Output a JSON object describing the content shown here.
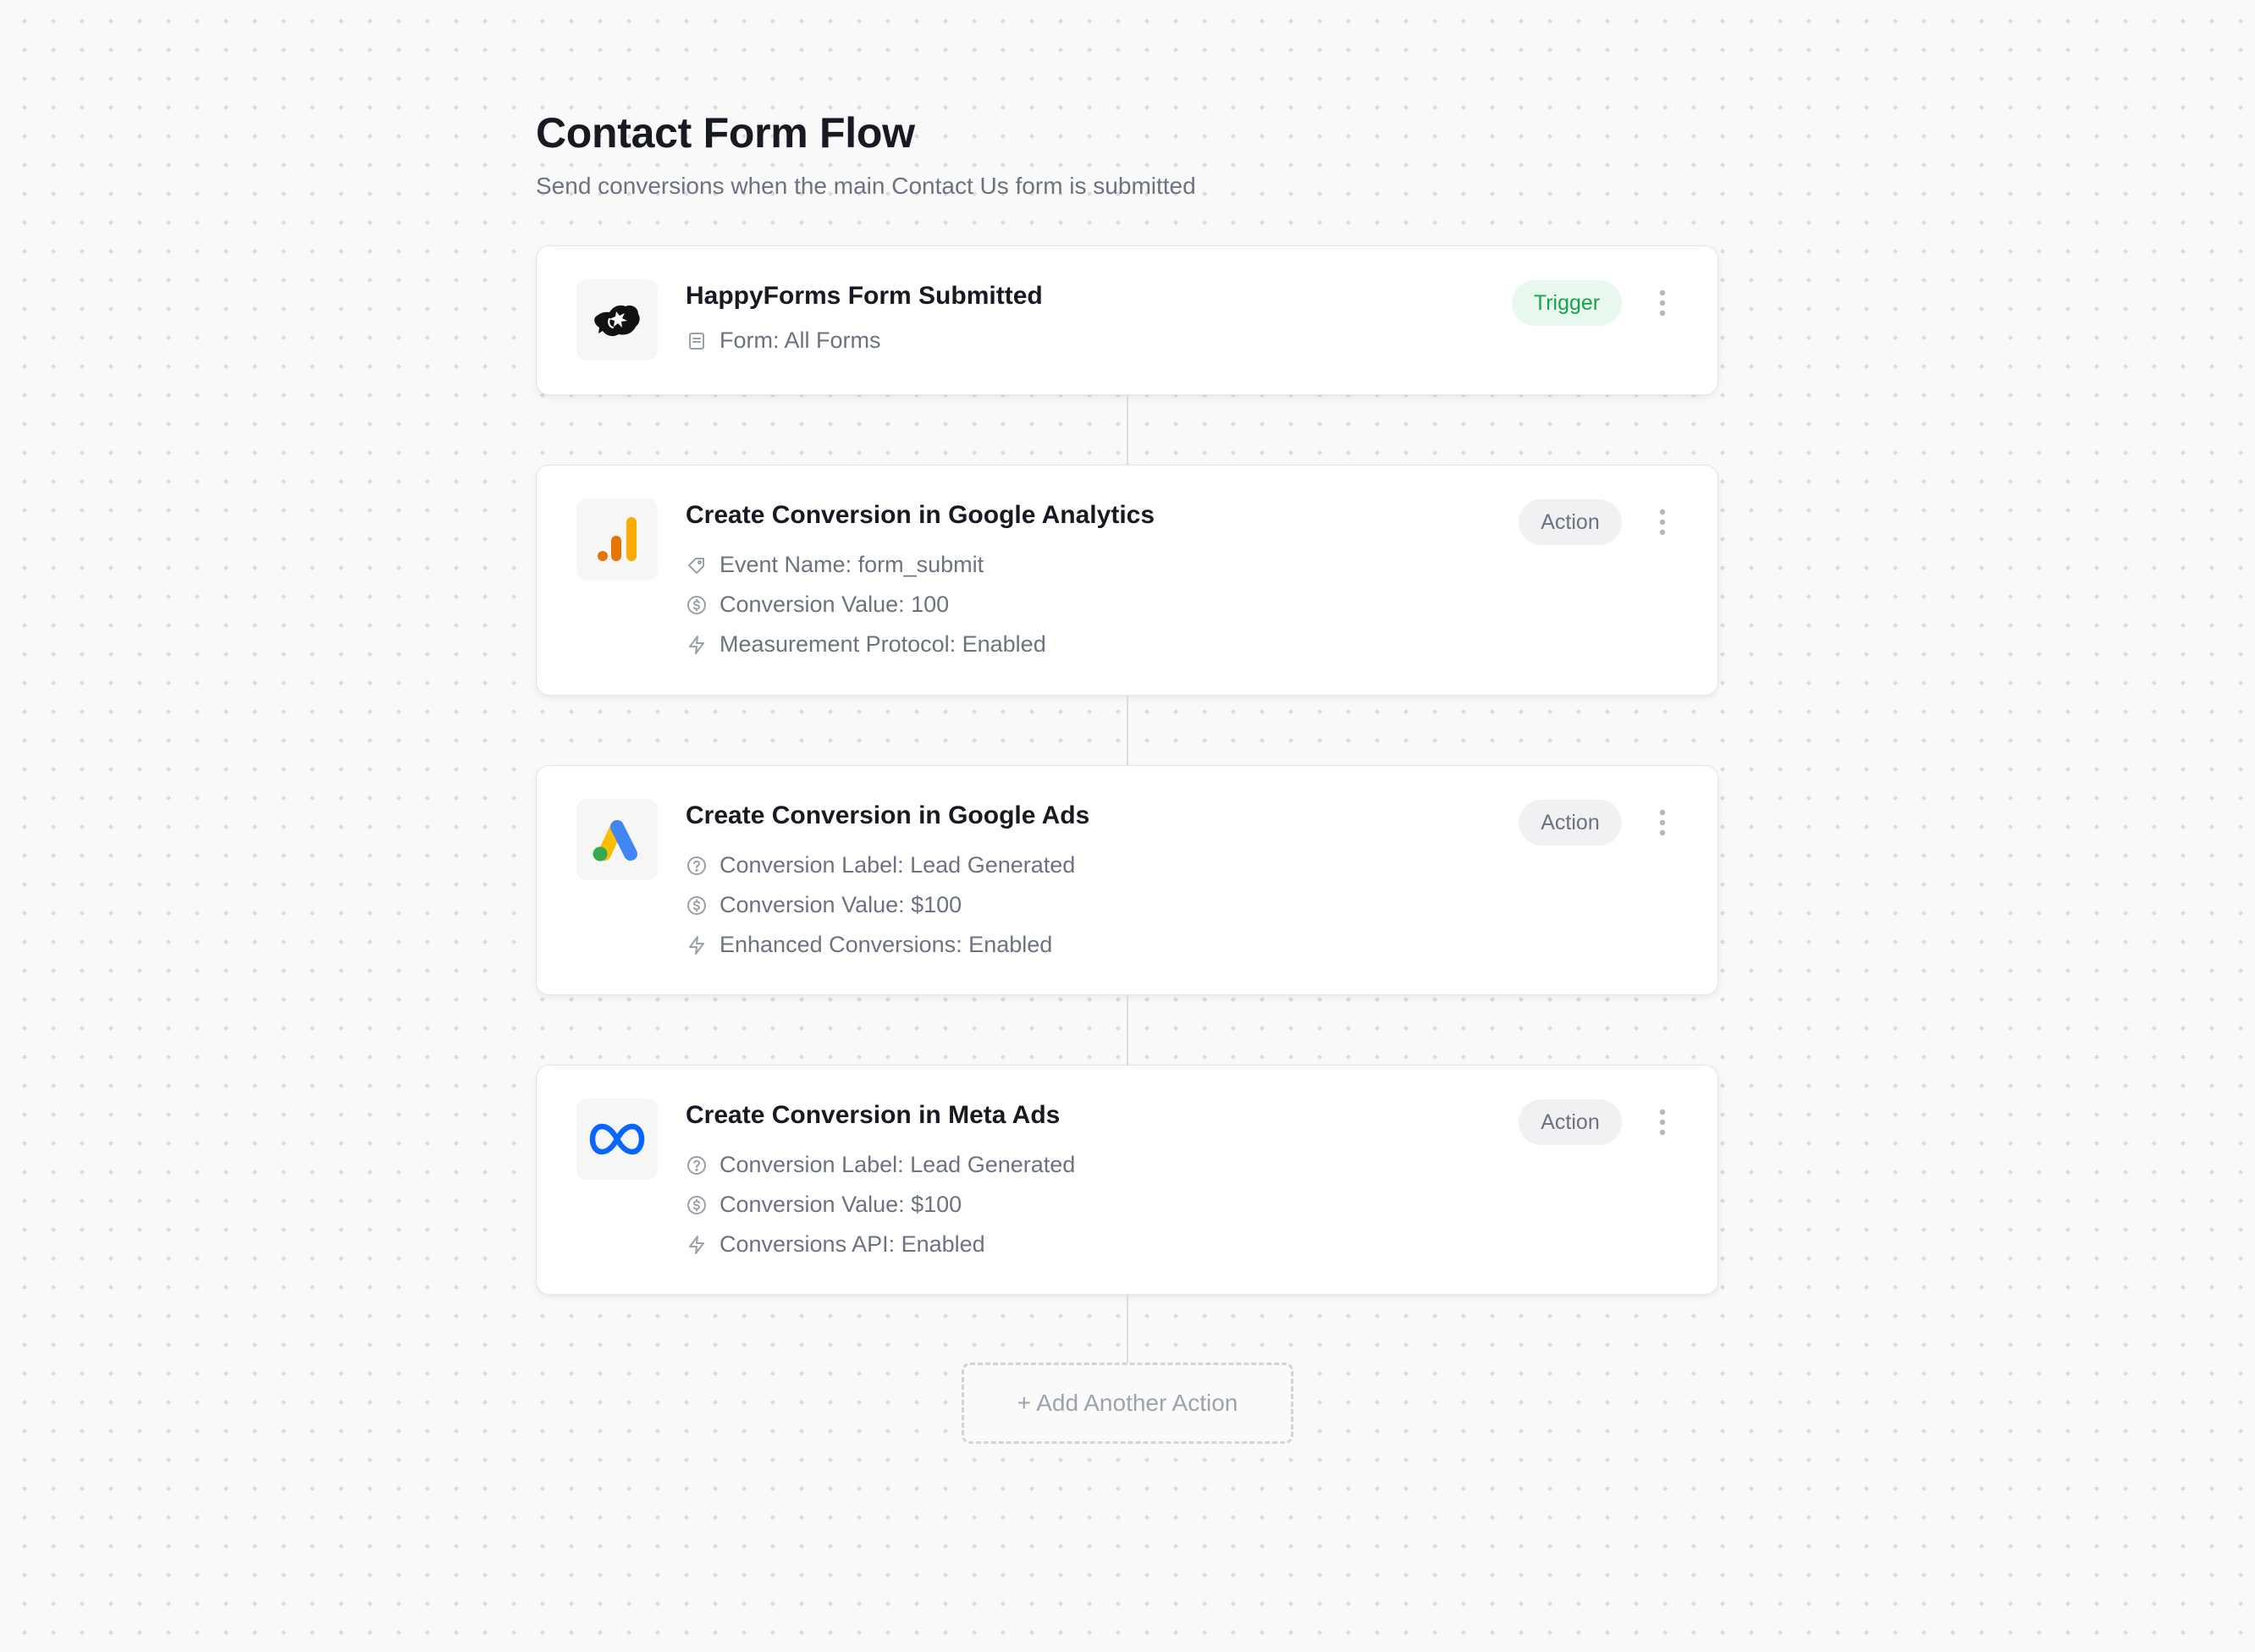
{
  "header": {
    "title": "Contact Form Flow",
    "subtitle": "Send conversions when the main Contact Us form is submitted"
  },
  "steps": [
    {
      "title": "HappyForms Form Submitted",
      "badge": "Trigger",
      "icon": "happyforms-logo",
      "details": [
        {
          "icon": "document-icon",
          "text": "Form: All Forms"
        }
      ]
    },
    {
      "title": "Create Conversion in Google Analytics",
      "badge": "Action",
      "icon": "google-analytics-logo",
      "details": [
        {
          "icon": "tag-icon",
          "text": "Event Name: form_submit"
        },
        {
          "icon": "dollar-circle-icon",
          "text": "Conversion Value: 100"
        },
        {
          "icon": "lightning-icon",
          "text": "Measurement Protocol: Enabled"
        }
      ]
    },
    {
      "title": "Create Conversion in Google Ads",
      "badge": "Action",
      "icon": "google-ads-logo",
      "details": [
        {
          "icon": "help-circle-icon",
          "text": "Conversion Label: Lead Generated"
        },
        {
          "icon": "dollar-circle-icon",
          "text": "Conversion Value: $100"
        },
        {
          "icon": "lightning-icon",
          "text": "Enhanced Conversions: Enabled"
        }
      ]
    },
    {
      "title": "Create Conversion in Meta Ads",
      "badge": "Action",
      "icon": "meta-logo",
      "details": [
        {
          "icon": "help-circle-icon",
          "text": "Conversion Label: Lead Generated"
        },
        {
          "icon": "dollar-circle-icon",
          "text": "Conversion Value: $100"
        },
        {
          "icon": "lightning-icon",
          "text": "Conversions API: Enabled"
        }
      ]
    }
  ],
  "add_action_label": "+ Add Another Action",
  "colors": {
    "trigger_badge_bg": "#e9f8ee",
    "trigger_badge_text": "#16a34a",
    "action_badge_bg": "#f1f1f3",
    "action_badge_text": "#6b7280",
    "google_analytics_orange": "#e37400",
    "google_analytics_yellow": "#f9ab00",
    "google_ads_blue": "#4285f4",
    "google_ads_yellow": "#fbbc04",
    "google_ads_green": "#34a853",
    "meta_blue": "#0866ff"
  }
}
